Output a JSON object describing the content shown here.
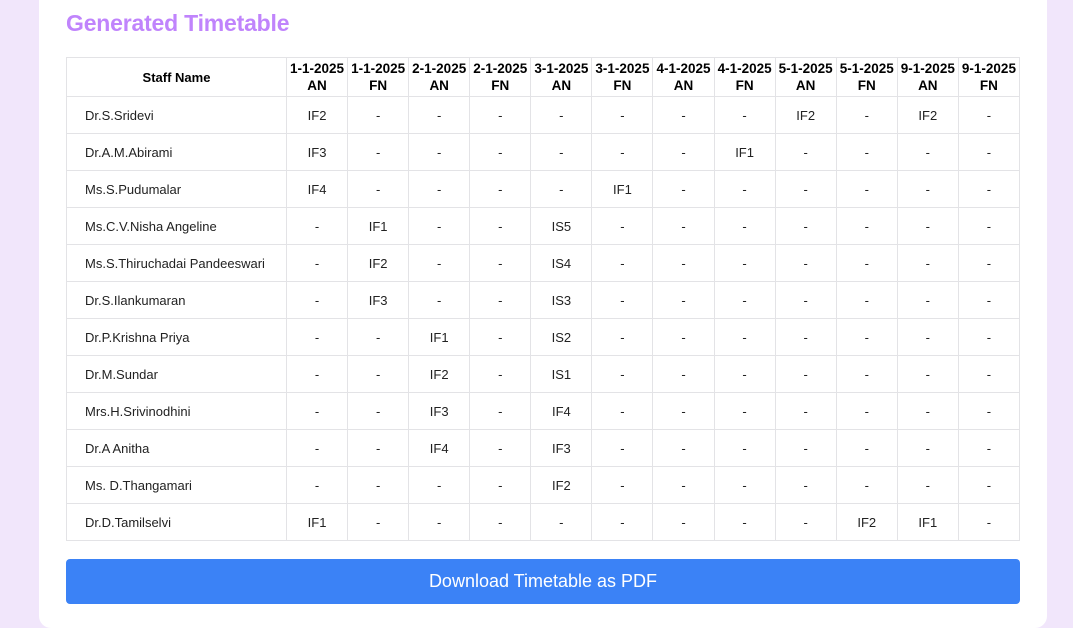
{
  "header": {
    "title": "Generated Timetable"
  },
  "table": {
    "staff_header": "Staff Name",
    "columns": [
      {
        "date": "1-1-2025",
        "session": "AN"
      },
      {
        "date": "1-1-2025",
        "session": "FN"
      },
      {
        "date": "2-1-2025",
        "session": "AN"
      },
      {
        "date": "2-1-2025",
        "session": "FN"
      },
      {
        "date": "3-1-2025",
        "session": "AN"
      },
      {
        "date": "3-1-2025",
        "session": "FN"
      },
      {
        "date": "4-1-2025",
        "session": "AN"
      },
      {
        "date": "4-1-2025",
        "session": "FN"
      },
      {
        "date": "5-1-2025",
        "session": "AN"
      },
      {
        "date": "5-1-2025",
        "session": "FN"
      },
      {
        "date": "9-1-2025",
        "session": "AN"
      },
      {
        "date": "9-1-2025",
        "session": "FN"
      }
    ],
    "rows": [
      {
        "name": "Dr.S.Sridevi",
        "cells": [
          "IF2",
          "-",
          "-",
          "-",
          "-",
          "-",
          "-",
          "-",
          "IF2",
          "-",
          "IF2",
          "-"
        ]
      },
      {
        "name": "Dr.A.M.Abirami",
        "cells": [
          "IF3",
          "-",
          "-",
          "-",
          "-",
          "-",
          "-",
          "IF1",
          "-",
          "-",
          "-",
          "-"
        ]
      },
      {
        "name": "Ms.S.Pudumalar",
        "cells": [
          "IF4",
          "-",
          "-",
          "-",
          "-",
          "IF1",
          "-",
          "-",
          "-",
          "-",
          "-",
          "-"
        ]
      },
      {
        "name": "Ms.C.V.Nisha Angeline",
        "cells": [
          "-",
          "IF1",
          "-",
          "-",
          "IS5",
          "-",
          "-",
          "-",
          "-",
          "-",
          "-",
          "-"
        ]
      },
      {
        "name": "Ms.S.Thiruchadai Pandeeswari",
        "cells": [
          "-",
          "IF2",
          "-",
          "-",
          "IS4",
          "-",
          "-",
          "-",
          "-",
          "-",
          "-",
          "-"
        ]
      },
      {
        "name": "Dr.S.Ilankumaran",
        "cells": [
          "-",
          "IF3",
          "-",
          "-",
          "IS3",
          "-",
          "-",
          "-",
          "-",
          "-",
          "-",
          "-"
        ]
      },
      {
        "name": "Dr.P.Krishna Priya",
        "cells": [
          "-",
          "-",
          "IF1",
          "-",
          "IS2",
          "-",
          "-",
          "-",
          "-",
          "-",
          "-",
          "-"
        ]
      },
      {
        "name": "Dr.M.Sundar",
        "cells": [
          "-",
          "-",
          "IF2",
          "-",
          "IS1",
          "-",
          "-",
          "-",
          "-",
          "-",
          "-",
          "-"
        ]
      },
      {
        "name": "Mrs.H.Srivinodhini",
        "cells": [
          "-",
          "-",
          "IF3",
          "-",
          "IF4",
          "-",
          "-",
          "-",
          "-",
          "-",
          "-",
          "-"
        ]
      },
      {
        "name": "Dr.A Anitha",
        "cells": [
          "-",
          "-",
          "IF4",
          "-",
          "IF3",
          "-",
          "-",
          "-",
          "-",
          "-",
          "-",
          "-"
        ]
      },
      {
        "name": "Ms. D.Thangamari",
        "cells": [
          "-",
          "-",
          "-",
          "-",
          "IF2",
          "-",
          "-",
          "-",
          "-",
          "-",
          "-",
          "-"
        ]
      },
      {
        "name": "Dr.D.Tamilselvi",
        "cells": [
          "IF1",
          "-",
          "-",
          "-",
          "-",
          "-",
          "-",
          "-",
          "-",
          "IF2",
          "IF1",
          "-"
        ]
      }
    ]
  },
  "actions": {
    "download_label": "Download Timetable as PDF"
  },
  "colors": {
    "accent_title": "#c084fc",
    "button_bg": "#3b82f6",
    "page_bg": "#f1e6fb"
  }
}
